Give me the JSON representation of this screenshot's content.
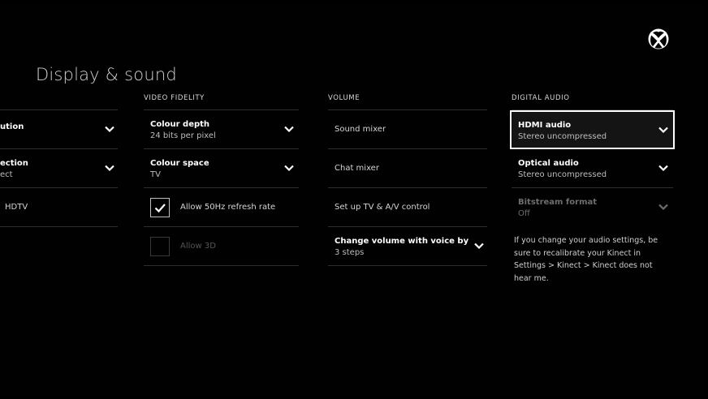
{
  "page": {
    "title": "Display & sound"
  },
  "colors": {
    "background": "#000000",
    "text": "#ffffff",
    "muted": "#bdbdbd",
    "divider": "#2e2e2e",
    "focus": "#ffffff"
  },
  "left_column": {
    "items": [
      {
        "label": "ution",
        "icon": "chevron-down-icon"
      },
      {
        "label": "ection",
        "sub": "ect",
        "icon": "chevron-down-icon"
      },
      {
        "label": "HDTV"
      }
    ]
  },
  "video_fidelity": {
    "header": "VIDEO FIDELITY",
    "items": [
      {
        "label": "Colour depth",
        "sub": "24 bits per pixel",
        "icon": "chevron-down-icon"
      },
      {
        "label": "Colour space",
        "sub": "TV",
        "icon": "chevron-down-icon"
      }
    ],
    "checkboxes": [
      {
        "label": "Allow 50Hz refresh rate",
        "checked": true,
        "enabled": true
      },
      {
        "label": "Allow 3D",
        "checked": false,
        "enabled": false
      }
    ]
  },
  "volume": {
    "header": "VOLUME",
    "items": [
      {
        "label": "Sound mixer"
      },
      {
        "label": "Chat mixer"
      },
      {
        "label": "Set up TV & A/V control"
      },
      {
        "label": "Change volume with voice by",
        "sub": "3 steps",
        "icon": "chevron-down-icon"
      }
    ]
  },
  "digital_audio": {
    "header": "DIGITAL AUDIO",
    "items": [
      {
        "label": "HDMI audio",
        "sub": "Stereo uncompressed",
        "focused": true,
        "icon": "chevron-down-icon"
      },
      {
        "label": "Optical audio",
        "sub": "Stereo uncompressed",
        "icon": "chevron-down-icon"
      },
      {
        "label": "Bitstream format",
        "sub": "Off",
        "enabled": false,
        "icon": "chevron-down-icon"
      }
    ],
    "note": "If you change your audio settings, be sure to recalibrate your Kinect in Settings > Kinect > Kinect does not hear me."
  },
  "icons": {
    "logo": "xbox-logo-icon",
    "checkmark": "checkmark-icon"
  }
}
